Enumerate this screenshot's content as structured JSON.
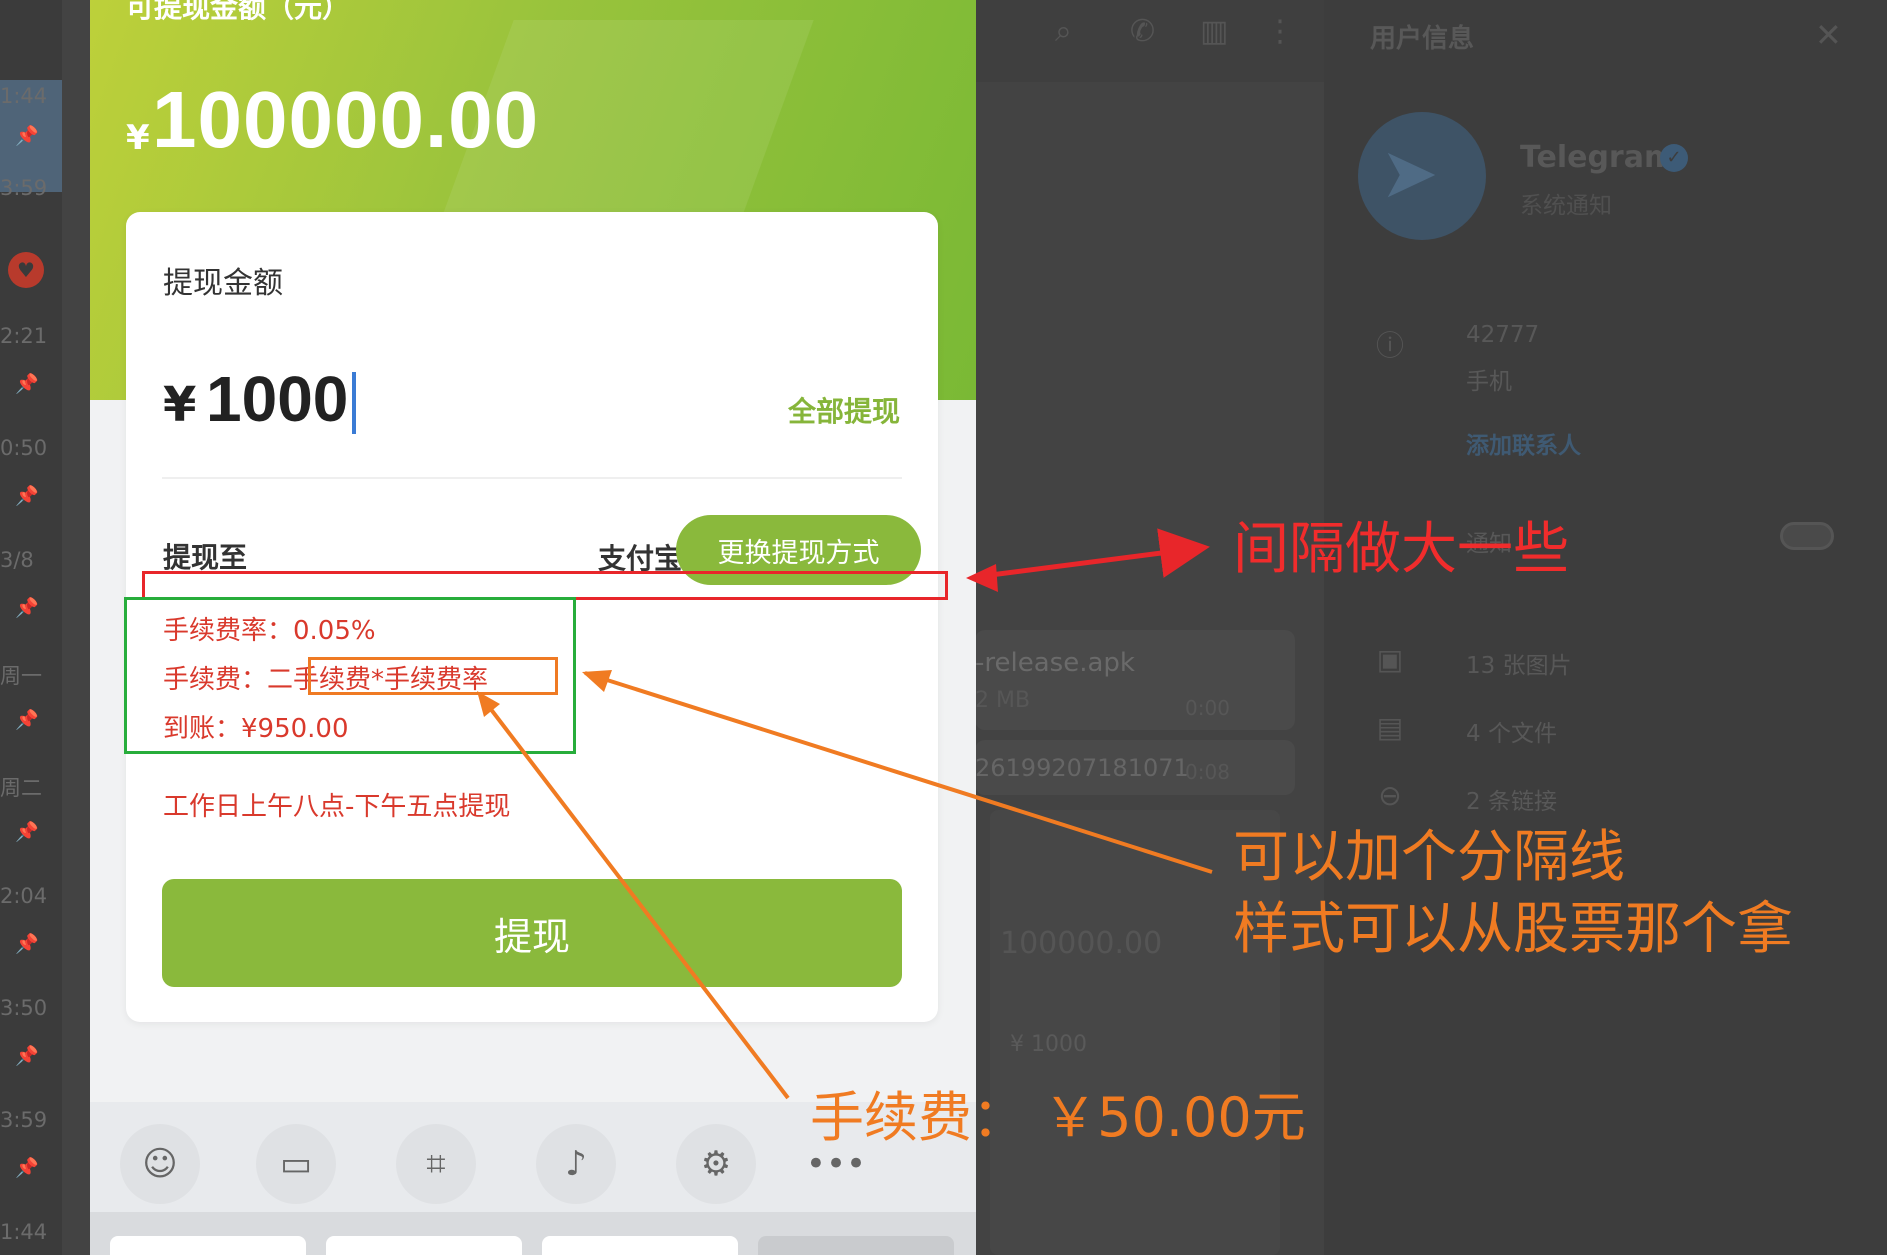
{
  "left_strip": {
    "times": [
      "1:44",
      "3:59",
      "2:21",
      "0:50",
      "3/8",
      "周一",
      "周二",
      "2:04",
      "3:50",
      "3:59",
      "1:44"
    ]
  },
  "phone": {
    "hero": {
      "label": "可提现金额（元）",
      "currency": "¥",
      "amount": "100000.00"
    },
    "card": {
      "title": "提现金额",
      "currency": "¥",
      "amount_value": "1000",
      "withdraw_all": "全部提现",
      "to_label": "提现至",
      "method": "支付宝",
      "change_method": "更换提现方式",
      "fee_rate": "手续费率：0.05%",
      "fee_label": "手续费：",
      "fee_formula": "二手续费*手续费率",
      "net_received": "到账：¥950.00",
      "work_hours": "工作日上午八点-下午五点提现",
      "submit": "提现"
    },
    "toolbar": {
      "icons": [
        "smile-icon",
        "clipboard-icon",
        "keypad-icon",
        "mic-icon",
        "gear-icon",
        "more-icon"
      ]
    }
  },
  "chat_bg": {
    "file_name": "-release.apk",
    "file_size": "2 MB",
    "file_time": "0:00",
    "number": "26199207181071",
    "number_time": "0:08",
    "mini_amount": "100000.00",
    "mini_input": "¥ 1000"
  },
  "right_panel": {
    "title": "用户信息",
    "contact_name": "Telegram",
    "contact_sub": "系统通知",
    "phone": "42777",
    "phone_label": "手机",
    "add_contact": "添加联系人",
    "notify": "通知",
    "photos": "13 张图片",
    "files": "4 个文件",
    "links": "2 条链接"
  },
  "annotations": {
    "red_note": "间隔做大一些",
    "orange_note_1": "可以加个分隔线",
    "orange_note_2": "样式可以从股票那个拿",
    "fee_note": "手续费：  ￥50.00元",
    "colors": {
      "red": "#f12c2c",
      "orange": "#f07b22",
      "green": "#27ad3b"
    }
  }
}
